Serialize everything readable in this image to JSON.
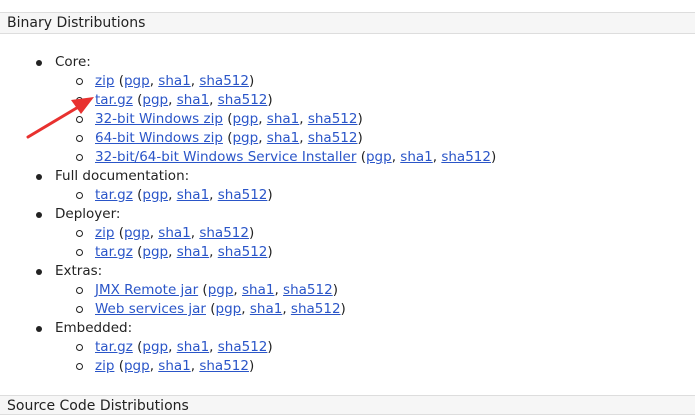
{
  "sections": {
    "binary_title": "Binary Distributions",
    "source_title": "Source Code Distributions"
  },
  "groups": [
    {
      "label": "Core:",
      "items": [
        {
          "main": "zip",
          "pgp": "pgp",
          "sha1": "sha1",
          "sha512": "sha512"
        },
        {
          "main": "tar.gz",
          "pgp": "pgp",
          "sha1": "sha1",
          "sha512": "sha512"
        },
        {
          "main": "32-bit Windows zip",
          "pgp": "pgp",
          "sha1": "sha1",
          "sha512": "sha512"
        },
        {
          "main": "64-bit Windows zip",
          "pgp": "pgp",
          "sha1": "sha1",
          "sha512": "sha512"
        },
        {
          "main": "32-bit/64-bit Windows Service Installer",
          "pgp": "pgp",
          "sha1": "sha1",
          "sha512": "sha512"
        }
      ]
    },
    {
      "label": "Full documentation:",
      "items": [
        {
          "main": "tar.gz",
          "pgp": "pgp",
          "sha1": "sha1",
          "sha512": "sha512"
        }
      ]
    },
    {
      "label": "Deployer:",
      "items": [
        {
          "main": "zip",
          "pgp": "pgp",
          "sha1": "sha1",
          "sha512": "sha512"
        },
        {
          "main": "tar.gz",
          "pgp": "pgp",
          "sha1": "sha1",
          "sha512": "sha512"
        }
      ]
    },
    {
      "label": "Extras:",
      "items": [
        {
          "main": "JMX Remote jar",
          "pgp": "pgp",
          "sha1": "sha1",
          "sha512": "sha512"
        },
        {
          "main": "Web services jar",
          "pgp": "pgp",
          "sha1": "sha1",
          "sha512": "sha512"
        }
      ]
    },
    {
      "label": "Embedded:",
      "items": [
        {
          "main": "tar.gz",
          "pgp": "pgp",
          "sha1": "sha1",
          "sha512": "sha512"
        },
        {
          "main": "zip",
          "pgp": "pgp",
          "sha1": "sha1",
          "sha512": "sha512"
        }
      ]
    }
  ],
  "colors": {
    "link": "#2a55c8",
    "annotation_arrow": "#e8312f"
  },
  "annotation": {
    "icon": "red-arrow-icon",
    "points_to": "Core: tar.gz"
  }
}
